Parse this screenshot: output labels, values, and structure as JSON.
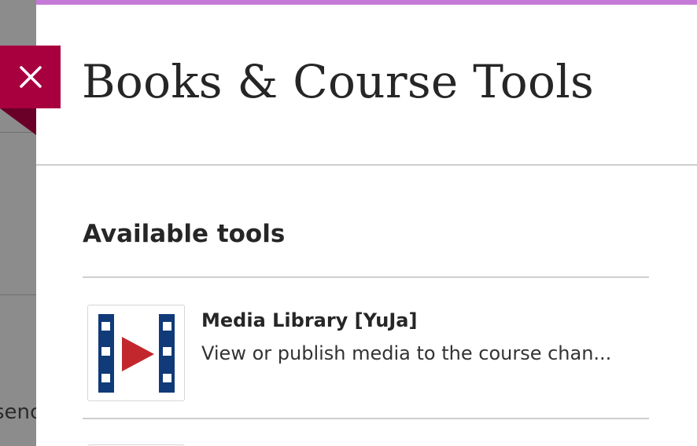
{
  "panel": {
    "title": "Books & Course Tools",
    "close_label": "Close"
  },
  "section": {
    "title": "Available tools"
  },
  "tools": [
    {
      "name": "Media Library [YuJa]",
      "description": "View or publish media to the course chan...",
      "icon": "film-play-icon"
    }
  ],
  "background": {
    "partial_text": "senc"
  },
  "colors": {
    "accent_bar": "#c47ad6",
    "close_tab": "#a8003f",
    "icon_blue": "#103a78",
    "icon_red": "#c1272d"
  }
}
